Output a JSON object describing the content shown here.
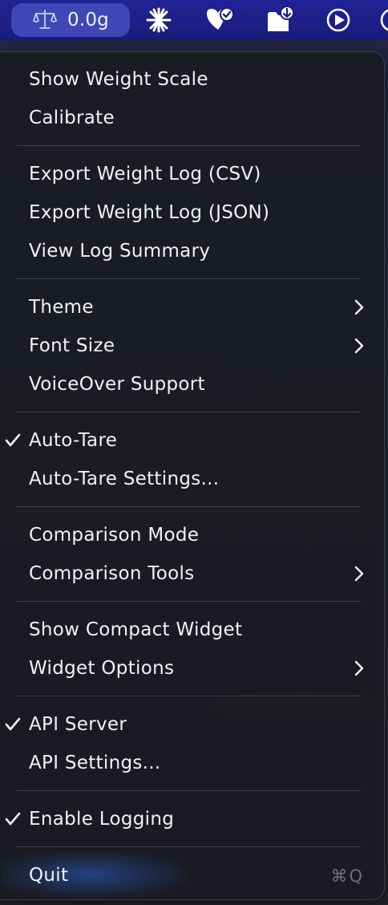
{
  "menubar": {
    "weight_readout": "0.0g",
    "icons": [
      "scale-icon",
      "sparkle-icon",
      "checklist-heart-icon",
      "folder-download-icon",
      "play-circle-icon"
    ]
  },
  "menu": {
    "items": [
      {
        "label": "Show Weight Scale"
      },
      {
        "label": "Calibrate"
      },
      {
        "label": "Export Weight Log (CSV)"
      },
      {
        "label": "Export Weight Log (JSON)"
      },
      {
        "label": "View Log Summary"
      },
      {
        "label": "Theme",
        "submenu": true
      },
      {
        "label": "Font Size",
        "submenu": true
      },
      {
        "label": "VoiceOver Support"
      },
      {
        "label": "Auto-Tare",
        "checked": true
      },
      {
        "label": "Auto-Tare Settings..."
      },
      {
        "label": "Comparison Mode"
      },
      {
        "label": "Comparison Tools",
        "submenu": true
      },
      {
        "label": "Show Compact Widget"
      },
      {
        "label": "Widget Options",
        "submenu": true
      },
      {
        "label": "API Server",
        "checked": true
      },
      {
        "label": "API Settings..."
      },
      {
        "label": "Enable Logging",
        "checked": true
      },
      {
        "label": "Quit",
        "highlighted": true,
        "shortcut": "⌘Q"
      }
    ]
  },
  "colors": {
    "menubar": "#1d1f8a",
    "status_pill": "#3d48b6",
    "menu_bg": "#1a1b21",
    "menu_text": "#f2f2f5",
    "shortcut_text": "#6f7080",
    "highlight": "#285fc8"
  }
}
